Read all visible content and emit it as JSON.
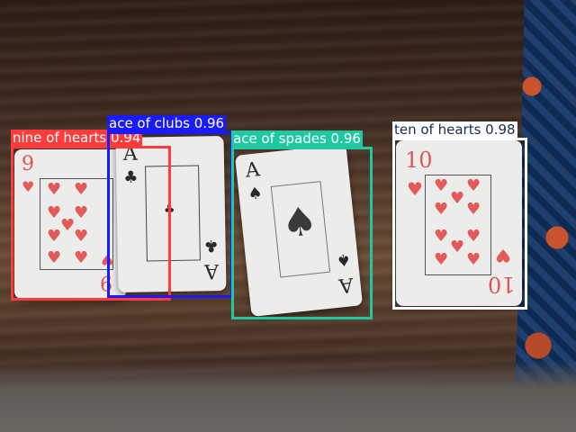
{
  "detections": [
    {
      "label": "nine of hearts 0.94",
      "color": "#ff3b3b",
      "text_color": "#ffffff"
    },
    {
      "label": "ace of clubs 0.96",
      "color": "#1a1aff",
      "text_color": "#ffffff"
    },
    {
      "label": "ace of spades 0.96",
      "color": "#1fc8a0",
      "text_color": "#ffffff"
    },
    {
      "label": "ten of hearts 0.98",
      "color": "#ffffff",
      "text_color": "#1a2a5a"
    }
  ],
  "cards": {
    "nine_hearts": {
      "rank": "9",
      "suit": "♥"
    },
    "ace_clubs": {
      "rank": "A",
      "suit": "♣"
    },
    "ace_spades": {
      "rank": "A",
      "suit": "♠"
    },
    "ten_hearts": {
      "rank": "10",
      "suit": "♥"
    }
  }
}
